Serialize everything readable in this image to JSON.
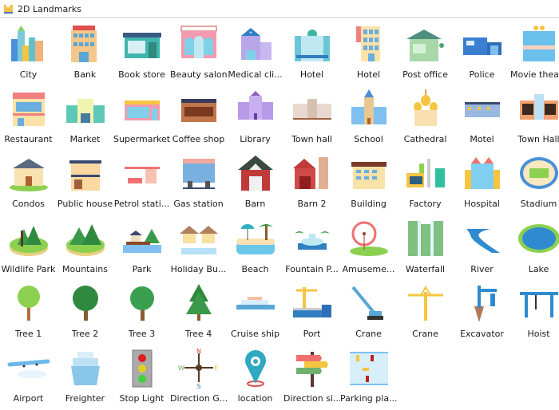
{
  "header": {
    "title": "2D Landmarks",
    "icon": "landmarks-library-icon"
  },
  "items": [
    {
      "label": "City",
      "icon": "city-icon",
      "kind": "city"
    },
    {
      "label": "Bank",
      "icon": "bank-icon",
      "kind": "bank"
    },
    {
      "label": "Book store",
      "icon": "book-store-icon",
      "kind": "store"
    },
    {
      "label": "Beauty salon",
      "icon": "beauty-salon-icon",
      "kind": "salon"
    },
    {
      "label": "Medical cli...",
      "icon": "medical-clinic-icon",
      "kind": "clinic"
    },
    {
      "label": "Hotel",
      "icon": "hotel-icon",
      "kind": "hotel"
    },
    {
      "label": "Hotel",
      "icon": "hotel-tower-icon",
      "kind": "hotel2"
    },
    {
      "label": "Post office",
      "icon": "post-office-icon",
      "kind": "post"
    },
    {
      "label": "Police",
      "icon": "police-icon",
      "kind": "police"
    },
    {
      "label": "Movie thea...",
      "icon": "movie-theater-icon",
      "kind": "movie"
    },
    {
      "label": "Restaurant",
      "icon": "restaurant-icon",
      "kind": "restaurant"
    },
    {
      "label": "Market",
      "icon": "market-icon",
      "kind": "market"
    },
    {
      "label": "Supermarket",
      "icon": "supermarket-icon",
      "kind": "supermarket"
    },
    {
      "label": "Coffee shop",
      "icon": "coffee-shop-icon",
      "kind": "coffee"
    },
    {
      "label": "Library",
      "icon": "library-icon",
      "kind": "library"
    },
    {
      "label": "Town hall",
      "icon": "town-hall-icon",
      "kind": "townhall"
    },
    {
      "label": "School",
      "icon": "school-icon",
      "kind": "school"
    },
    {
      "label": "Cathedral",
      "icon": "cathedral-icon",
      "kind": "cathedral"
    },
    {
      "label": "Motel",
      "icon": "motel-icon",
      "kind": "motel"
    },
    {
      "label": "Town Hall",
      "icon": "town-hall-2-icon",
      "kind": "townhall2"
    },
    {
      "label": "Condos",
      "icon": "condos-icon",
      "kind": "condos"
    },
    {
      "label": "Public house",
      "icon": "public-house-icon",
      "kind": "pubhouse"
    },
    {
      "label": "Petrol stati...",
      "icon": "petrol-station-icon",
      "kind": "petrol"
    },
    {
      "label": "Gas station",
      "icon": "gas-station-icon",
      "kind": "gas"
    },
    {
      "label": "Barn",
      "icon": "barn-icon",
      "kind": "barn"
    },
    {
      "label": "Barn 2",
      "icon": "barn-2-icon",
      "kind": "barn2"
    },
    {
      "label": "Building",
      "icon": "building-icon",
      "kind": "building"
    },
    {
      "label": "Factory",
      "icon": "factory-icon",
      "kind": "factory"
    },
    {
      "label": "Hospital",
      "icon": "hospital-icon",
      "kind": "hospital"
    },
    {
      "label": "Stadium",
      "icon": "stadium-icon",
      "kind": "stadium"
    },
    {
      "label": "Wildlife Park",
      "icon": "wildlife-park-icon",
      "kind": "wildlife"
    },
    {
      "label": "Mountains",
      "icon": "mountains-icon",
      "kind": "mountains"
    },
    {
      "label": "Park",
      "icon": "park-icon",
      "kind": "park"
    },
    {
      "label": "Holiday Bu...",
      "icon": "holiday-bungalow-icon",
      "kind": "bungalow"
    },
    {
      "label": "Beach",
      "icon": "beach-icon",
      "kind": "beach"
    },
    {
      "label": "Fountain P...",
      "icon": "fountain-park-icon",
      "kind": "fountain"
    },
    {
      "label": "Amuseme...",
      "icon": "amusement-park-icon",
      "kind": "amusement"
    },
    {
      "label": "Waterfall",
      "icon": "waterfall-icon",
      "kind": "waterfall"
    },
    {
      "label": "River",
      "icon": "river-icon",
      "kind": "river"
    },
    {
      "label": "Lake",
      "icon": "lake-icon",
      "kind": "lake"
    },
    {
      "label": "Tree 1",
      "icon": "tree-1-icon",
      "kind": "tree1"
    },
    {
      "label": "Tree 2",
      "icon": "tree-2-icon",
      "kind": "tree2"
    },
    {
      "label": "Tree 3",
      "icon": "tree-3-icon",
      "kind": "tree3"
    },
    {
      "label": "Tree 4",
      "icon": "tree-4-icon",
      "kind": "tree4"
    },
    {
      "label": "Cruise ship",
      "icon": "cruise-ship-icon",
      "kind": "cruise"
    },
    {
      "label": "Port",
      "icon": "port-icon",
      "kind": "port"
    },
    {
      "label": "Crane",
      "icon": "crawler-crane-icon",
      "kind": "crane1"
    },
    {
      "label": "Crane",
      "icon": "tower-crane-icon",
      "kind": "crane2"
    },
    {
      "label": "Excavator",
      "icon": "excavator-icon",
      "kind": "excavator"
    },
    {
      "label": "Hoist",
      "icon": "hoist-icon",
      "kind": "hoist"
    },
    {
      "label": "Airport",
      "icon": "airport-icon",
      "kind": "airport"
    },
    {
      "label": "Freighter",
      "icon": "freighter-icon",
      "kind": "freighter"
    },
    {
      "label": "Stop Light",
      "icon": "stop-light-icon",
      "kind": "stoplight"
    },
    {
      "label": "Direction G...",
      "icon": "compass-icon",
      "kind": "compass"
    },
    {
      "label": "location",
      "icon": "location-pin-icon",
      "kind": "location"
    },
    {
      "label": "Direction si...",
      "icon": "direction-sign-icon",
      "kind": "signpost"
    },
    {
      "label": "Parking pla...",
      "icon": "parking-lot-icon",
      "kind": "parking"
    }
  ]
}
